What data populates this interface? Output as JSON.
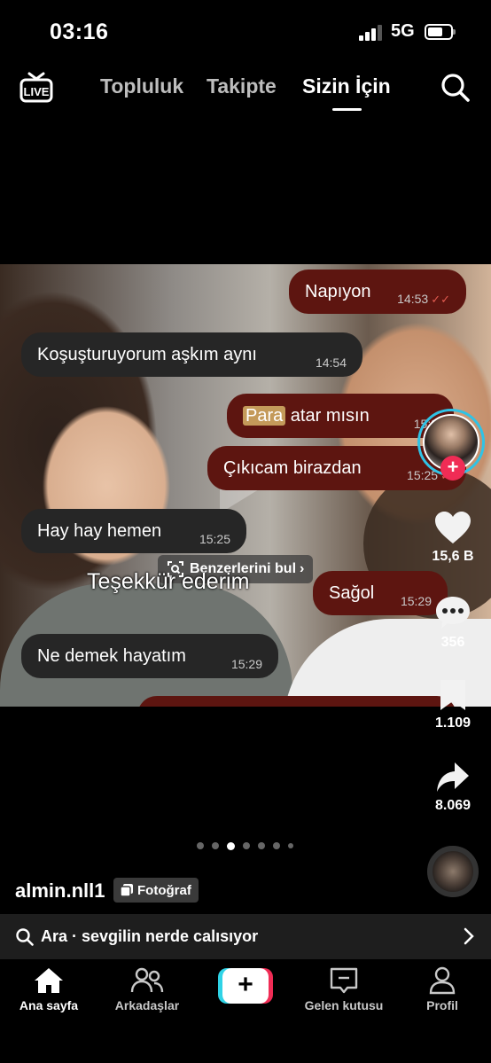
{
  "status_bar": {
    "time": "03:16",
    "network": "5G"
  },
  "top_nav": {
    "live_label": "LIVE",
    "tabs": [
      {
        "label": "Topluluk",
        "active": false
      },
      {
        "label": "Takipte",
        "active": false
      },
      {
        "label": "Sizin İçin",
        "active": true
      }
    ]
  },
  "post": {
    "messages": [
      {
        "side": "right",
        "text": "Napıyon",
        "time": "14:53",
        "ticks": "✓✓"
      },
      {
        "side": "left",
        "text": "Koşuşturuyorum aşkım aynı",
        "time": "14:54"
      },
      {
        "side": "right",
        "highlight": "Para",
        "text": " atar mısın",
        "time": "15:2"
      },
      {
        "side": "right",
        "text": "Çıkıcam birazdan",
        "time": "15:25",
        "ticks": "✓"
      },
      {
        "side": "left",
        "text": "Hay hay hemen",
        "time": "15:25"
      },
      {
        "side": "right",
        "text": "Sağol",
        "time": "15:29"
      },
      {
        "side": "left",
        "text": "Ne demek hayatım",
        "time": "15:29"
      }
    ],
    "caption_overlay": "Teşekkür ederim",
    "similar_button": "Benzerlerini bul",
    "likes": "15,6 B",
    "comments": "356",
    "saves": "1.109",
    "shares": "8.069",
    "carousel": {
      "count": 7,
      "active": 2
    },
    "username": "almin.nll1",
    "type_badge": "Fotoğraf",
    "colors": {
      "follow": "#f02c55",
      "ring": "#2fc3e6",
      "bubble_right": "#5d1510",
      "bubble_left": "#262626"
    }
  },
  "search": {
    "prefix": "Ara",
    "separator": " · ",
    "query": "sevgilin nerde calısıyor"
  },
  "bottom_nav": {
    "items": [
      {
        "label": "Ana sayfa",
        "icon": "home-icon",
        "active": true
      },
      {
        "label": "Arkadaşlar",
        "icon": "friends-icon",
        "active": false
      },
      {
        "label": "Gelen kutusu",
        "icon": "inbox-icon",
        "active": false
      },
      {
        "label": "Profil",
        "icon": "profile-icon",
        "active": false
      }
    ]
  }
}
